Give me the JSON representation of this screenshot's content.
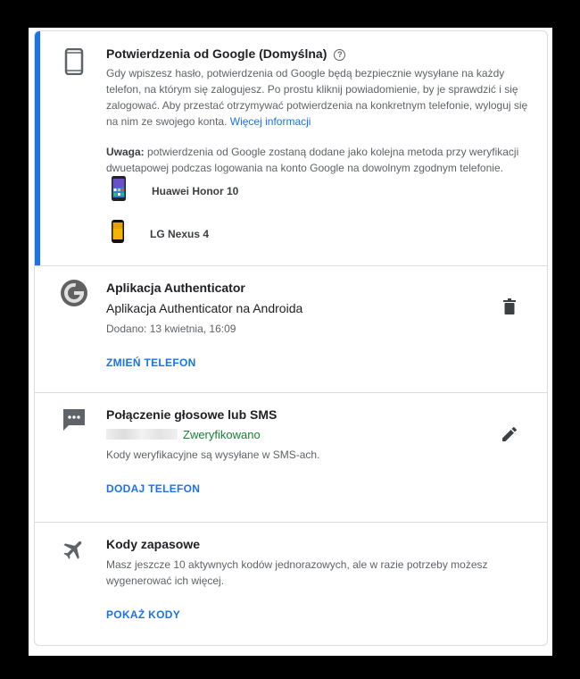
{
  "google_prompts": {
    "title": "Potwierdzenia od Google (Domyślna)",
    "help_icon": "?",
    "description": "Gdy wpiszesz hasło, potwierdzenia od Google będą bezpiecznie wysyłane na każdy telefon, na którym się zalogujesz. Po prostu kliknij powiadomienie, by je sprawdzić i się zalogować. Aby przestać otrzymywać potwierdzenia na konkretnym telefonie, wyloguj się na nim ze swojego konta.",
    "more_info_link": "Więcej informacji",
    "note_label": "Uwaga:",
    "note_text": " potwierdzenia od Google zostaną dodane jako kolejna metoda przy weryfikacji dwuetapowej podczas logowania na konto Google na dowolnym zgodnym telefonie.",
    "phones": [
      {
        "name": "Huawei Honor 10"
      },
      {
        "name": "LG Nexus 4"
      }
    ],
    "accent_color": "#1a73e8"
  },
  "authenticator": {
    "title": "Aplikacja Authenticator",
    "subtitle": "Aplikacja Authenticator na Androida",
    "added": "Dodano: 13 kwietnia, 16:09",
    "action": "ZMIEŃ TELEFON"
  },
  "voice_sms": {
    "title": "Połączenie głosowe lub SMS",
    "status": "Zweryfikowano",
    "description": "Kody weryfikacyjne są wysyłane w SMS-ach.",
    "action": "DODAJ TELEFON",
    "status_color": "#188038"
  },
  "backup_codes": {
    "title": "Kody zapasowe",
    "description": "Masz jeszcze 10 aktywnych kodów jednorazowych, ale w razie potrzeby możesz wygenerować ich więcej.",
    "action": "POKAŻ KODY"
  }
}
